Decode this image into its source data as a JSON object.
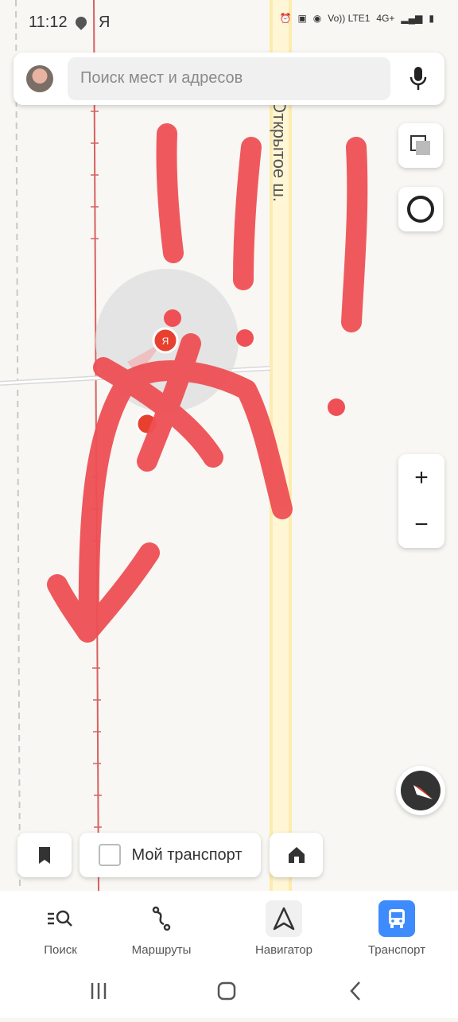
{
  "status": {
    "time": "11:12",
    "ya": "Я",
    "net": "Vo)) LTE1",
    "gen": "4G+"
  },
  "search": {
    "placeholder": "Поиск мест и адресов"
  },
  "map": {
    "road_label": "Открытое ш.",
    "user_marker": "Я"
  },
  "bottom_controls": {
    "my_transport_label": "Мой транспорт"
  },
  "nav": {
    "items": [
      {
        "label": "Поиск",
        "icon": "search-list-icon"
      },
      {
        "label": "Маршруты",
        "icon": "route-icon"
      },
      {
        "label": "Навигатор",
        "icon": "navigator-arrow-icon"
      },
      {
        "label": "Транспорт",
        "icon": "bus-icon",
        "active": true
      }
    ]
  },
  "colors": {
    "accent": "#3d8bfd",
    "marker": "#e8402f",
    "scribble": "#ee5055",
    "road": "#fff3c4"
  }
}
